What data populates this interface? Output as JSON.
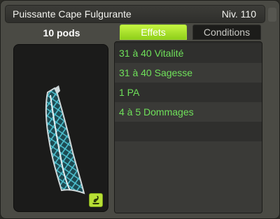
{
  "header": {
    "title": "Puissante Cape Fulgurante",
    "level": "Niv. 110"
  },
  "item": {
    "weight": "10 pods",
    "category_icon": "item-category-icon"
  },
  "tabs": [
    {
      "label": "Effets",
      "active": true
    },
    {
      "label": "Conditions",
      "active": false
    }
  ],
  "effects": [
    "31 à 40 Vitalité",
    "31 à 40 Sagesse",
    "1 PA",
    "4 à 5 Dommages",
    ""
  ],
  "colors": {
    "effect_text": "#6fe05a",
    "active_tab": "#b8e035",
    "cape_teal": "#3fa7b5"
  }
}
